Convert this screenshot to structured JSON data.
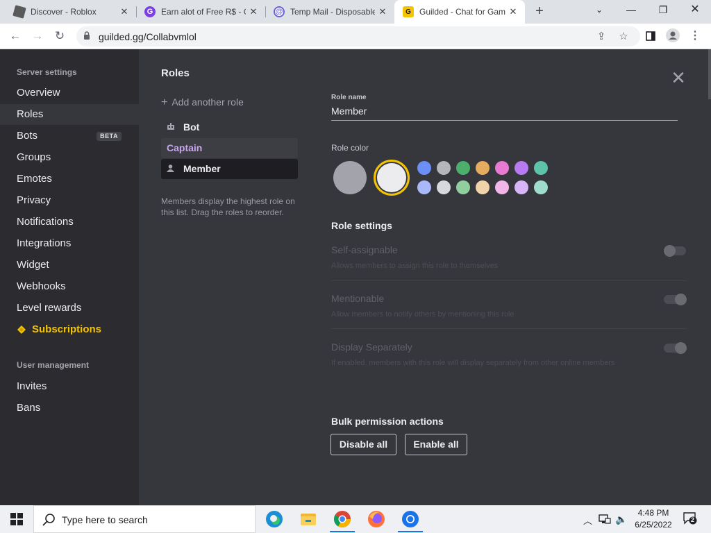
{
  "browser": {
    "tabs": [
      {
        "title": "Discover - Roblox",
        "icon": "roblox-icon",
        "active": false
      },
      {
        "title": "Earn alot of Free R$ - G",
        "icon": "gplus-icon",
        "active": false
      },
      {
        "title": "Temp Mail - Disposable",
        "icon": "tempmail-icon",
        "active": false
      },
      {
        "title": "Guilded - Chat for Gam",
        "icon": "guilded-icon",
        "active": true
      }
    ],
    "url": "guilded.gg/Collabvmlol"
  },
  "sidebar": {
    "server_settings_heading": "Server settings",
    "items": [
      {
        "label": "Overview"
      },
      {
        "label": "Roles"
      },
      {
        "label": "Bots",
        "badge": "BETA"
      },
      {
        "label": "Groups"
      },
      {
        "label": "Emotes"
      },
      {
        "label": "Privacy"
      },
      {
        "label": "Notifications"
      },
      {
        "label": "Integrations"
      },
      {
        "label": "Widget"
      },
      {
        "label": "Webhooks"
      },
      {
        "label": "Level rewards"
      },
      {
        "label": "Subscriptions"
      }
    ],
    "user_management_heading": "User management",
    "user_items": [
      {
        "label": "Invites"
      },
      {
        "label": "Bans"
      }
    ]
  },
  "roles_panel": {
    "title": "Roles",
    "add_role": "Add another role",
    "roles": [
      {
        "name": "Bot",
        "color": "#ececee"
      },
      {
        "name": "Captain",
        "color": "#c9a5f0"
      },
      {
        "name": "Member",
        "color": "#ececee"
      }
    ],
    "hint": "Members display the highest role on this list. Drag the roles to reorder."
  },
  "editor": {
    "role_name_label": "Role name",
    "role_name_value": "Member",
    "role_color_label": "Role color",
    "colors": {
      "big": [
        "#a3a3ab",
        "#ececee"
      ],
      "row1": [
        "#6c8ef7",
        "#b5b5bb",
        "#4caf6b",
        "#e3ac5e",
        "#e87ad3",
        "#b77af0",
        "#5ec4a9"
      ],
      "row2": [
        "#a9b8f9",
        "#d8d8dc",
        "#92cf9e",
        "#f0d3a8",
        "#f1b6e7",
        "#d7b5f6",
        "#9fdccb"
      ],
      "selected_ring": "#f5c400"
    },
    "role_settings_heading": "Role settings",
    "settings": [
      {
        "title": "Self-assignable",
        "desc": "Allows members to assign this role to themselves",
        "on": false
      },
      {
        "title": "Mentionable",
        "desc": "Allow members to notify others by mentioning this role",
        "on": true
      },
      {
        "title": "Display Separately",
        "desc": "If enabled, members with this role will display separately from other online members",
        "on": true
      }
    ],
    "bulk_heading": "Bulk permission actions",
    "disable_all": "Disable all",
    "enable_all": "Enable all"
  },
  "taskbar": {
    "search_placeholder": "Type here to search",
    "time": "4:48 PM",
    "date": "6/25/2022",
    "notification_count": "2"
  },
  "colors": {
    "sidebar_bg": "#2b2b30",
    "main_bg": "#36363d",
    "accent_gold": "#f5c400"
  }
}
